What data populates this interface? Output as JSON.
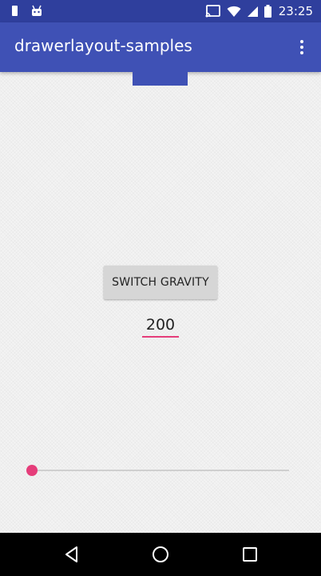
{
  "status_bar": {
    "time": "23:25",
    "icons": [
      "sim-icon",
      "android-icon",
      "cast-icon",
      "wifi-icon",
      "signal-icon",
      "battery-icon"
    ]
  },
  "app_bar": {
    "title": "drawerlayout-samples",
    "menu_icon": "more-vert-icon",
    "background": "#3f51b5"
  },
  "content": {
    "switch_button_label": "SWITCH GRAVITY",
    "value_field": "200",
    "slider_value_fraction": 0.0
  },
  "nav_bar": {
    "icons": [
      "back-icon",
      "home-icon",
      "recents-icon"
    ]
  },
  "colors": {
    "primary": "#3f51b5",
    "primary_dark": "#2f3f9d",
    "accent": "#e53d7a"
  }
}
